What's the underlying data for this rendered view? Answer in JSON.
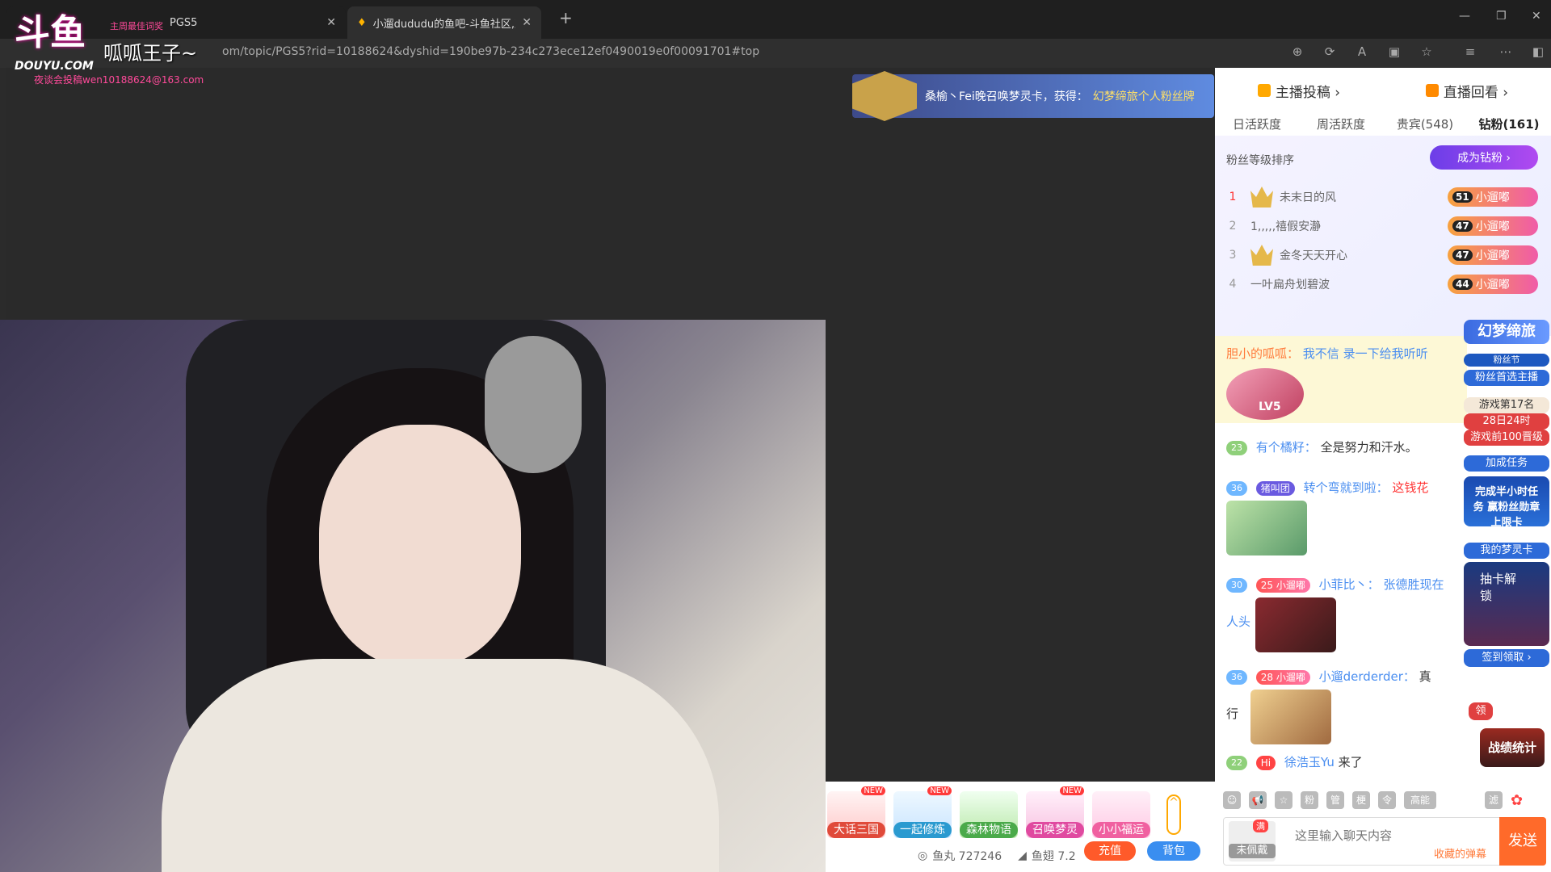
{
  "browser": {
    "tabs": [
      {
        "title": "PGS5"
      },
      {
        "title": "小遛dududu的鱼吧-斗鱼社区,直播"
      }
    ],
    "new_tab": "+",
    "url": "om/topic/PGS5?rid=10188624&dyshid=190be97b-234c273ece12ef0490019e0f00091701#top",
    "window_controls": [
      "—",
      "❐",
      "✕"
    ]
  },
  "watermark": {
    "logo": "斗鱼",
    "name": "呱呱王子~",
    "site": "DOUYU.COM",
    "email": "夜谈会投稿wen10188624@163.com",
    "tag": "主周最佳词奖"
  },
  "banner": {
    "text": "桑榆丶Fei晚召唤梦灵卡，获得：",
    "highlight": "幻梦缔旅个人粉丝牌"
  },
  "sidebar": {
    "top_buttons": [
      {
        "label": "主播投稿 ›",
        "icon": "upload-icon"
      },
      {
        "label": "直播回看 ›",
        "icon": "replay-icon"
      }
    ],
    "rank_tabs": [
      "日活跃度",
      "周活跃度",
      "贵宾(548)",
      "钻粉(161)"
    ],
    "sort_label": "粉丝等级排序",
    "become_fan": "成为钻粉 ›",
    "rank": [
      {
        "no": "1",
        "name": "未末日的风",
        "level": "51",
        "badge": "小遛嘟"
      },
      {
        "no": "2",
        "name": "1,,,,,禧假安瀞",
        "level": "47",
        "badge": "小遛嘟"
      },
      {
        "no": "3",
        "name": "金冬天天开心",
        "level": "47",
        "badge": "小遛嘟"
      },
      {
        "no": "4",
        "name": "一叶扁舟划碧波",
        "level": "44",
        "badge": "小遛嘟"
      }
    ]
  },
  "chat": {
    "messages": [
      {
        "user": "胆小的呱呱：",
        "text": "我不信 录一下给我听听",
        "level": "LV5"
      },
      {
        "level": "23",
        "user": "有个橘籽：",
        "text": "全是努力和汗水。"
      },
      {
        "level": "36",
        "fan": "猪叫团",
        "user": "转个弯就到啦：",
        "text": "这钱花"
      },
      {
        "level": "30",
        "fan": "25 小遛嘟",
        "user": "小菲比丶：",
        "text": "张德胜现在",
        "tail": "人头"
      },
      {
        "level": "36",
        "fan": "28 小遛嘟",
        "user": "小遛derderder：",
        "text": "真",
        "tail": "行"
      },
      {
        "level": "22",
        "user": "徐浩玉Yu",
        "text": "来了",
        "badge": "Hi"
      }
    ],
    "input_placeholder": "这里输入聊天内容",
    "collect": "收藏的弹幕",
    "send": "发送",
    "no_badge": "未佩戴",
    "full": "满",
    "tools": [
      "☺",
      "📢",
      "☆",
      "粉",
      "管",
      "梗",
      "令",
      "高能",
      "滤"
    ]
  },
  "side_ads": {
    "event": "幻梦缔旅",
    "fan_festival": "粉丝节",
    "fan_pick": "粉丝首选主播",
    "rank_text": "游戏第17名",
    "deadline": "28日24时",
    "goal": "游戏前100晋级",
    "task": "加成任务",
    "task_desc": "完成半小时任务 赢粉丝勋章上限卡",
    "card": "我的梦灵卡",
    "card_desc": "抽卡解锁",
    "sign": "签到领取 ›",
    "stats": "战绩统计",
    "claim": "领"
  },
  "bottom": {
    "games": [
      {
        "label": "大话三国",
        "new": "NEW"
      },
      {
        "label": "一起修炼",
        "new": "NEW"
      },
      {
        "label": "森林物语",
        "new": ""
      },
      {
        "label": "召唤梦灵",
        "new": "NEW"
      },
      {
        "label": "小小福运",
        "new": ""
      }
    ],
    "fish_balls": "鱼丸 727246",
    "fish_fins": "鱼翅 7.2",
    "recharge": "充值",
    "bag": "背包"
  },
  "colors": {
    "accent": "#ff6a2a",
    "chat_user": "#4a8ef0",
    "fan_gradient": "#f05ca8"
  }
}
